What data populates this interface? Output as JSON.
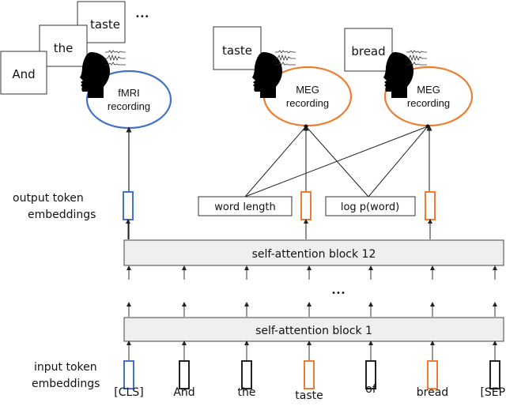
{
  "stimuli": {
    "fmri_words": [
      "And",
      "the",
      "taste"
    ],
    "fmri_ellipsis": "•••",
    "meg_words": [
      "taste",
      "bread"
    ]
  },
  "recordings": [
    {
      "line1": "fMRI",
      "line2": "recording",
      "color": "#4472c4"
    },
    {
      "line1": "MEG",
      "line2": "recording",
      "color": "#ed7d31"
    },
    {
      "line1": "MEG",
      "line2": "recording",
      "color": "#ed7d31"
    }
  ],
  "labels": {
    "output_line1": "output token",
    "output_line2": "embeddings",
    "input_line1": "input token",
    "input_line2": "embeddings",
    "block12": "self-attention block 12",
    "block1": "self-attention block 1",
    "middle_ellipsis": "•••"
  },
  "features": {
    "word_length": "word length",
    "log_p_word": "log p(word)"
  },
  "tokens": [
    {
      "text": "[CLS]",
      "color": "#4472c4"
    },
    {
      "text": "And",
      "color": "#222222"
    },
    {
      "text": "the",
      "color": "#222222"
    },
    {
      "text": "taste",
      "color": "#ed7d31"
    },
    {
      "text": "of",
      "color": "#222222"
    },
    {
      "text": "bread",
      "color": "#ed7d31"
    },
    {
      "text": "[SEP]",
      "color": "#222222"
    }
  ],
  "colors": {
    "fmri": "#4472c4",
    "meg": "#ed7d31",
    "block_fill": "#efefef",
    "line": "#222222"
  }
}
